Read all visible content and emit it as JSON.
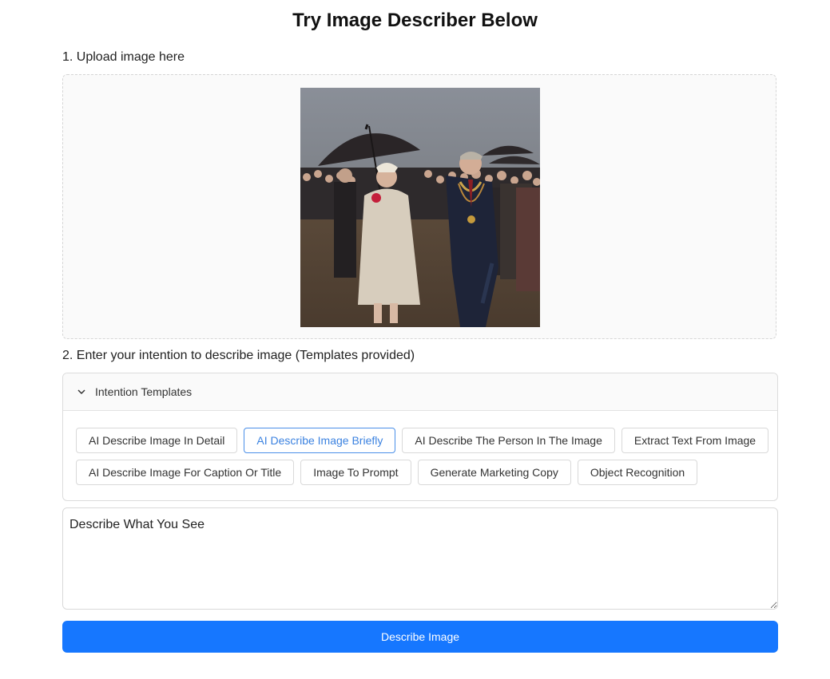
{
  "page": {
    "title": "Try Image Describer Below"
  },
  "step1": {
    "label": "1. Upload image here"
  },
  "uploaded_image": {
    "alt": "Uploaded photo: two people walking under umbrellas in front of a crowd"
  },
  "step2": {
    "label": "2. Enter your intention to describe image (Templates provided)"
  },
  "templates": {
    "header": "Intention Templates",
    "row1": [
      {
        "label": "AI Describe Image In Detail",
        "active": false
      },
      {
        "label": "AI Describe Image Briefly",
        "active": true
      },
      {
        "label": "AI Describe The Person In The Image",
        "active": false
      },
      {
        "label": "Extract Text From Image",
        "active": false
      }
    ],
    "row2": [
      {
        "label": "AI Describe Image For Caption Or Title",
        "active": false
      },
      {
        "label": "Image To Prompt",
        "active": false
      },
      {
        "label": "Generate Marketing Copy",
        "active": false
      },
      {
        "label": "Object Recognition",
        "active": false
      }
    ]
  },
  "prompt": {
    "value": "Describe What You See"
  },
  "submit": {
    "label": "Describe Image"
  },
  "colors": {
    "primary": "#1677ff",
    "active_chip": "#3b82e0"
  }
}
